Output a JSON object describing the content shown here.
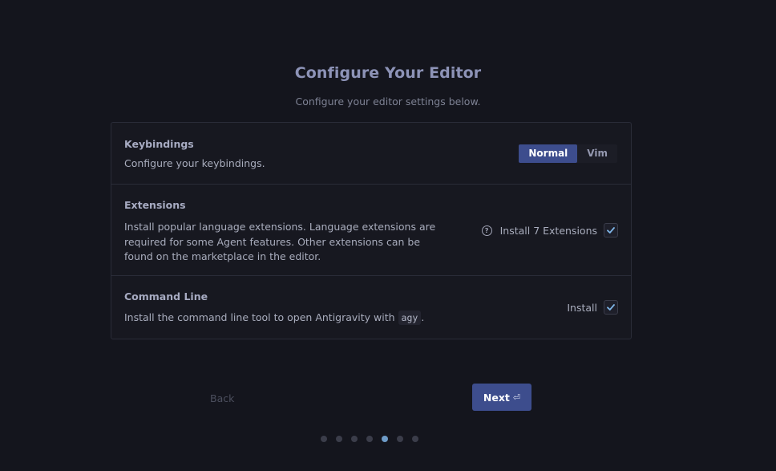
{
  "header": {
    "title": "Configure Your Editor",
    "subtitle": "Configure your editor settings below."
  },
  "keybindings": {
    "title": "Keybindings",
    "description": "Configure your keybindings.",
    "options": [
      "Normal",
      "Vim"
    ],
    "selected": "Normal"
  },
  "extensions": {
    "title": "Extensions",
    "description_lines": [
      "Install popular language extensions. Language extensions are",
      "required for some Agent features. Other extensions can be",
      "found on the marketplace in the editor."
    ],
    "option_label": "Install 7 Extensions",
    "checked": true,
    "help_icon": "help-circle-icon"
  },
  "command_line": {
    "title": "Command Line",
    "description_prefix": "Install the command line tool to open Antigravity with",
    "command": "agy",
    "description_suffix": ".",
    "option_label": "Install",
    "checked": true
  },
  "footer": {
    "back_label": "Back",
    "next_label": "Next",
    "next_icon": "enter-icon",
    "step_count": 7,
    "current_step": 5
  },
  "colors": {
    "accent": "#3d4d8d",
    "background": "#14151d",
    "active_dot": "#6e9cc8"
  }
}
